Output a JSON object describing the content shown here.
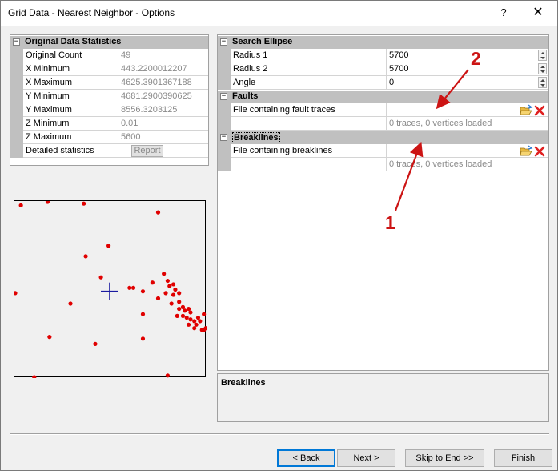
{
  "window": {
    "title": "Grid Data - Nearest Neighbor - Options",
    "help_label": "?",
    "close_label": "✕"
  },
  "stats": {
    "header": "Original Data Statistics",
    "toggle": "−",
    "rows": [
      {
        "name": "Original Count",
        "value": "49"
      },
      {
        "name": "X Minimum",
        "value": "443.2200012207"
      },
      {
        "name": "X Maximum",
        "value": "4625.3901367188"
      },
      {
        "name": "Y Minimum",
        "value": "4681.2900390625"
      },
      {
        "name": "Y Maximum",
        "value": "8556.3203125"
      },
      {
        "name": "Z Minimum",
        "value": "0.01"
      },
      {
        "name": "Z Maximum",
        "value": "5600"
      },
      {
        "name": "Detailed statistics",
        "value": ""
      }
    ],
    "report_button": "Report"
  },
  "options": {
    "search_ellipse": {
      "header": "Search Ellipse",
      "toggle": "−",
      "radius1": {
        "name": "Radius 1",
        "value": "5700"
      },
      "radius2": {
        "name": "Radius 2",
        "value": "5700"
      },
      "angle": {
        "name": "Angle",
        "value": "0"
      }
    },
    "faults": {
      "header": "Faults",
      "toggle": "−",
      "file": {
        "name": "File containing fault traces",
        "value": ""
      },
      "status": "0 traces, 0 vertices loaded"
    },
    "breaklines": {
      "header": "Breaklines",
      "toggle": "−",
      "file": {
        "name": "File containing breaklines",
        "value": ""
      },
      "status": "0 traces, 0 vertices loaded"
    }
  },
  "description": {
    "title": "Breaklines"
  },
  "preview": {
    "points": [
      [
        0.03,
        0.02
      ],
      [
        0.17,
        0.0
      ],
      [
        0.36,
        0.01
      ],
      [
        0.75,
        0.06
      ],
      [
        0.49,
        0.25
      ],
      [
        0.37,
        0.31
      ],
      [
        0.45,
        0.43
      ],
      [
        0.6,
        0.49
      ],
      [
        0.62,
        0.49
      ],
      [
        0.67,
        0.51
      ],
      [
        0.72,
        0.46
      ],
      [
        0.78,
        0.41
      ],
      [
        0.8,
        0.45
      ],
      [
        0.81,
        0.48
      ],
      [
        0.83,
        0.47
      ],
      [
        0.84,
        0.5
      ],
      [
        0.83,
        0.53
      ],
      [
        0.82,
        0.58
      ],
      [
        0.86,
        0.57
      ],
      [
        0.86,
        0.61
      ],
      [
        0.88,
        0.6
      ],
      [
        0.89,
        0.62
      ],
      [
        0.91,
        0.61
      ],
      [
        0.88,
        0.65
      ],
      [
        0.9,
        0.66
      ],
      [
        0.92,
        0.67
      ],
      [
        0.94,
        0.68
      ],
      [
        0.96,
        0.66
      ],
      [
        0.99,
        0.64
      ],
      [
        0.91,
        0.7
      ],
      [
        0.94,
        0.72
      ],
      [
        0.98,
        0.73
      ],
      [
        1.0,
        0.72
      ],
      [
        0.29,
        0.58
      ],
      [
        0.67,
        0.64
      ],
      [
        0.0,
        0.52
      ],
      [
        0.18,
        0.77
      ],
      [
        0.42,
        0.81
      ],
      [
        0.67,
        0.78
      ],
      [
        0.1,
        1.0
      ],
      [
        0.8,
        0.99
      ],
      [
        0.85,
        0.65
      ],
      [
        0.75,
        0.55
      ],
      [
        0.86,
        0.52
      ],
      [
        0.92,
        0.63
      ],
      [
        0.95,
        0.7
      ],
      [
        0.97,
        0.68
      ],
      [
        0.99,
        0.73
      ],
      [
        0.79,
        0.52
      ]
    ],
    "cursor": [
      0.5,
      0.51
    ]
  },
  "annotations": {
    "label1": "1",
    "label2": "2"
  },
  "buttons": {
    "back": "< Back",
    "next": "Next >",
    "skip": "Skip to End >>",
    "finish": "Finish"
  },
  "colors": {
    "points": "#e00000",
    "cursor": "#1a1aa0",
    "arrow": "#cc1414"
  }
}
